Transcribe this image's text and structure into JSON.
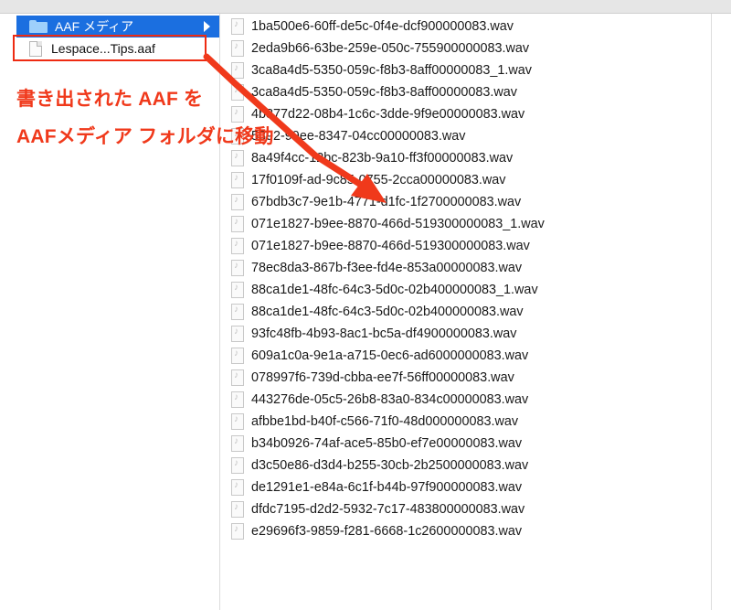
{
  "sidebar": {
    "folder_label": "AAF メディア",
    "file_label": "Lespace...Tips.aaf"
  },
  "annotation": {
    "line1": "書き出された AAF を",
    "line2": "AAFメディア フォルダに移動",
    "color": "#f0391b"
  },
  "accent_color": "#1b6fe0",
  "files": [
    "1ba500e6-60ff-de5c-0f4e-dcf900000083.wav",
    "2eda9b66-63be-259e-050c-755900000083.wav",
    "3ca8a4d5-5350-059c-f8b3-8aff00000083_1.wav",
    "3ca8a4d5-5350-059c-f8b3-8aff00000083.wav",
    "4b877d22-08b4-1c6c-3dde-9f9e00000083.wav",
    "5392-99ee-8347-04cc00000083.wav",
    "8a49f4cc-12bc-823b-9a10-ff3f00000083.wav",
    "17f0109f-ad-9c85-0755-2cca00000083.wav",
    "67bdb3c7-9e1b-4771-d1fc-1f2700000083.wav",
    "071e1827-b9ee-8870-466d-519300000083_1.wav",
    "071e1827-b9ee-8870-466d-519300000083.wav",
    "78ec8da3-867b-f3ee-fd4e-853a00000083.wav",
    "88ca1de1-48fc-64c3-5d0c-02b400000083_1.wav",
    "88ca1de1-48fc-64c3-5d0c-02b400000083.wav",
    "93fc48fb-4b93-8ac1-bc5a-df4900000083.wav",
    "609a1c0a-9e1a-a715-0ec6-ad6000000083.wav",
    "078997f6-739d-cbba-ee7f-56ff00000083.wav",
    "443276de-05c5-26b8-83a0-834c00000083.wav",
    "afbbe1bd-b40f-c566-71f0-48d000000083.wav",
    "b34b0926-74af-ace5-85b0-ef7e00000083.wav",
    "d3c50e86-d3d4-b255-30cb-2b2500000083.wav",
    "de1291e1-e84a-6c1f-b44b-97f900000083.wav",
    "dfdc7195-d2d2-5932-7c17-483800000083.wav",
    "e29696f3-9859-f281-6668-1c2600000083.wav"
  ]
}
